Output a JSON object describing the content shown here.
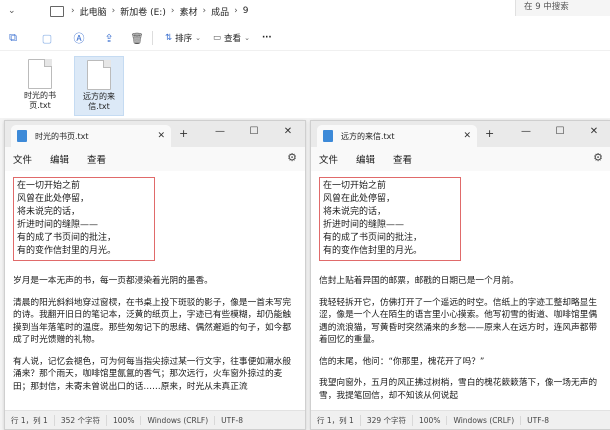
{
  "explorer": {
    "breadcrumb": [
      "此电脑",
      "新加卷 (E:)",
      "素材",
      "成品",
      "9"
    ],
    "search_placeholder": "在 9 中搜索",
    "toolbar": {
      "sort_label": "排序",
      "view_label": "查看",
      "more_label": "···"
    },
    "files": [
      {
        "name": "时光的书\n页.txt",
        "selected": false
      },
      {
        "name": "远方的来\n信.txt",
        "selected": true
      }
    ]
  },
  "notepads": [
    {
      "title": "时光的书页.txt",
      "menu": {
        "file": "文件",
        "edit": "编辑",
        "view": "查看"
      },
      "poem": [
        "在一切开始之前",
        "风曾在此处停留，",
        "将未说完的话，",
        "折进时间的缝隙——",
        "有的成了书页间的批注，",
        "有的变作信封里的月光。"
      ],
      "paragraphs": [
        "岁月是一本无声的书，每一页都浸染着光阴的墨香。",
        "清晨的阳光斜斜地穿过窗棂，在书桌上投下斑驳的影子，像是一首未写完的诗。我翻开旧日的笔记本，泛黄的纸页上，字迹已有些模糊，却仍能触摸到当年落笔时的温度。那些匆匆记下的思绪、偶然邂逅的句子，如今都成了时光馈赠的礼物。",
        "有人说，记忆会褪色，可为何每当指尖掠过某一行文字，往事便如潮水般涌来？那个雨天，咖啡馆里氤氲的香气；那次远行，火车窗外掠过的麦田；那封信，未寄未曾说出口的话……原来，时光从未真正流"
      ],
      "status": {
        "position": "行 1，列 1",
        "chars": "352 个字符",
        "zoom": "100%",
        "eol": "Windows (CRLF)",
        "encoding": "UTF-8"
      }
    },
    {
      "title": "远方的来信.txt",
      "menu": {
        "file": "文件",
        "edit": "编辑",
        "view": "查看"
      },
      "poem": [
        "在一切开始之前",
        "风曾在此处停留，",
        "将未说完的话，",
        "折进时间的缝隙——",
        "有的成了书页间的批注，",
        "有的变作信封里的月光。"
      ],
      "paragraphs": [
        "信封上贴着异国的邮票，邮戳的日期已是一个月前。",
        "我轻轻拆开它，仿佛打开了一个遥远的时空。信纸上的字迹工整却略显生涩，像是一个人在陌生的语言里小心摸索。他写初雪的街道、咖啡馆里偶遇的流浪猫，写黄昏时突然涌来的乡愁——原来人在远方时，连风声都带着回忆的重量。",
        "信的末尾，他问：“你那里，槐花开了吗？”",
        "我望向窗外，五月的风正拂过树梢，雪白的槐花簌簌落下，像一场无声的雪，我提笔回信，却不知该从何说起"
      ],
      "status": {
        "position": "行 1，列 1",
        "chars": "329 个字符",
        "zoom": "100%",
        "eol": "Windows (CRLF)",
        "encoding": "UTF-8"
      }
    }
  ]
}
